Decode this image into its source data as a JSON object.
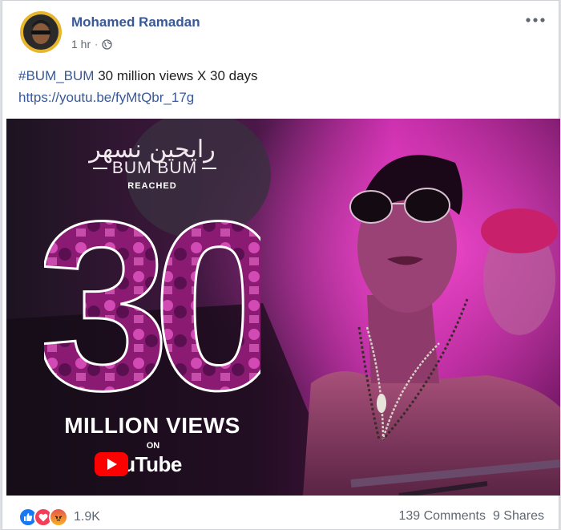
{
  "post": {
    "author": "Mohamed Ramadan",
    "time": "1 hr",
    "separator": "·",
    "privacy_icon": "globe-icon",
    "more_icon": "more-options-icon",
    "hashtag": "#BUM_BUM",
    "text": " 30 million views X 30 days",
    "link": "https://youtu.be/fyMtQbr_17g"
  },
  "media": {
    "arabic_title": "رايحين نسهر",
    "song_title": "BUM BUM",
    "reached": "REACHED",
    "number": "30",
    "views": "MILLION VIEWS",
    "on": "ON",
    "platform": "YouTube",
    "colors": {
      "magenta": "#d42bb5",
      "youtube_red": "#ff0000"
    }
  },
  "footer": {
    "reactions": [
      "like-icon",
      "love-icon",
      "angry-icon"
    ],
    "reaction_count": "1.9K",
    "comments": "139 Comments",
    "shares": "9 Shares"
  }
}
